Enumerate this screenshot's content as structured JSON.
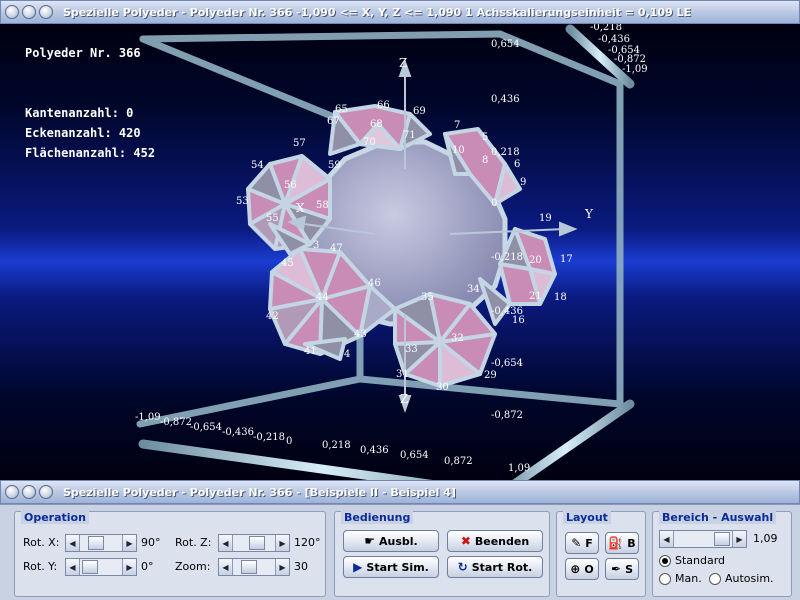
{
  "window_top": {
    "title": "Spezielle Polyeder - Polyeder Nr. 366   -1,090 <= X, Y, Z <= 1,090    1 Achsskalierungseinheit = 0,109 LE"
  },
  "window_bottom": {
    "title": "Spezielle Polyeder - Polyeder Nr. 366 - [Beispiele II - Beispiel 4]"
  },
  "info": {
    "polyeder": "Polyeder Nr. 366",
    "kanten": "Kantenanzahl: 0",
    "ecken": "Eckenanzahl: 420",
    "flaechen": "Flächenanzahl: 452"
  },
  "axes": {
    "x": "X",
    "y": "Y",
    "z1": "Z",
    "z2": "Z"
  },
  "vertex_labels": [
    "65",
    "66",
    "67",
    "68",
    "69",
    "70",
    "71",
    "7",
    "5",
    "6",
    "9",
    "10",
    "8",
    "54",
    "57",
    "56",
    "59",
    "53",
    "58",
    "55",
    "3",
    "19",
    "20",
    "17",
    "21",
    "18",
    "16",
    "45",
    "47",
    "46",
    "44",
    "43",
    "42",
    "41",
    "4",
    "35",
    "34",
    "33",
    "32",
    "31",
    "30",
    "29"
  ],
  "axis_ticks": {
    "top_right": [
      "-0,218",
      "-0,436",
      "-0,654",
      "-0,872",
      "-1,09"
    ],
    "vertical": [
      "0,654",
      "0,436",
      "0,218",
      "0",
      "-0,218",
      "-0,436",
      "-0,654",
      "-0,872",
      "1,09"
    ],
    "bottom": [
      "-1,09",
      "-0,872",
      "-0,654",
      "-0,436",
      "-0,218",
      "0",
      "0,218",
      "0,436",
      "0,654",
      "0,872"
    ]
  },
  "operation": {
    "title": "Operation",
    "rot_x_label": "Rot. X:",
    "rot_x_value": "90°",
    "rot_y_label": "Rot. Y:",
    "rot_y_value": "0°",
    "rot_z_label": "Rot. Z:",
    "rot_z_value": "120°",
    "zoom_label": "Zoom:",
    "zoom_value": "30"
  },
  "bedienung": {
    "title": "Bedienung",
    "ausbl": "Ausbl.",
    "beenden": "Beenden",
    "start_sim": "Start Sim.",
    "start_rot": "Start Rot."
  },
  "layout": {
    "title": "Layout",
    "f": "F",
    "b": "B",
    "o": "O",
    "s": "S"
  },
  "bereich": {
    "title": "Bereich - Auswahl",
    "value": "1,09",
    "standard": "Standard",
    "man": "Man.",
    "autosim": "Autosim."
  },
  "colors": {
    "accent": "#0a2a9a",
    "frame": "#a9c4d2",
    "face_pink": "#c98cb6",
    "face_gray": "#8f8fa8",
    "disk": "#a8aac8"
  }
}
